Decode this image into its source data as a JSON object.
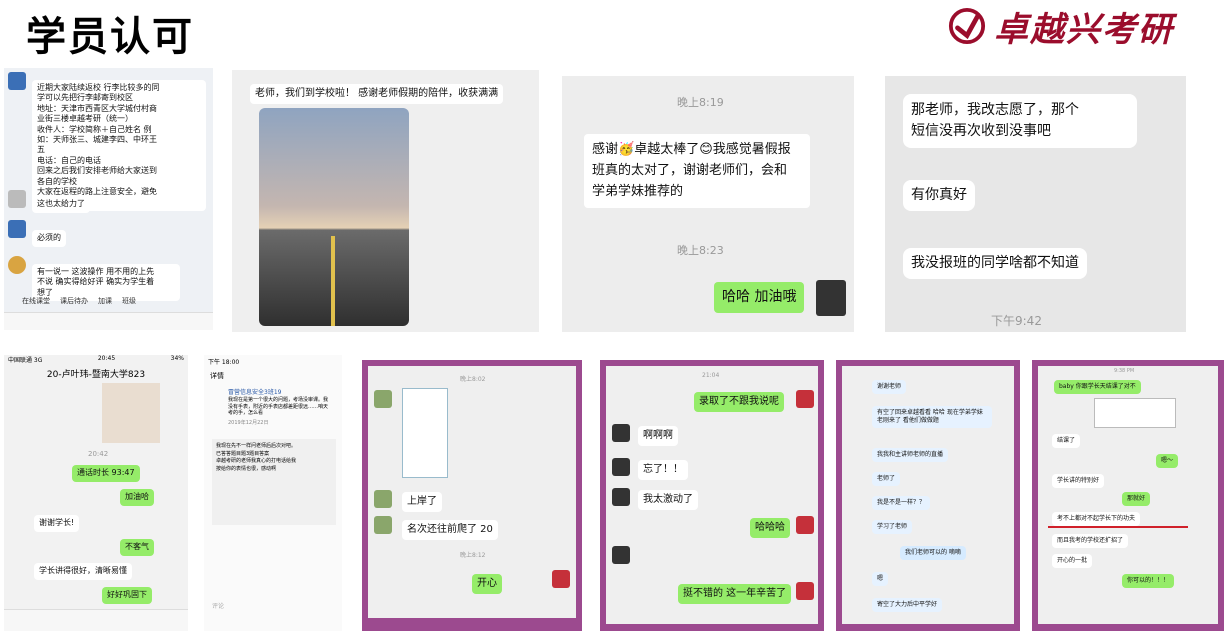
{
  "header": {
    "title": "学员认可",
    "brand": "卓越兴考研"
  },
  "shot1": {
    "msg1": [
      "近期大家陆续返校 行李比较多的同",
      "学可以先把行李邮寄到校区",
      "地址：天津市西青区大学城付村商",
      "业街三楼卓越考研（统一）",
      "收件人：学校简称＋自己姓名 例",
      "如：天师张三、城建李四、中环王",
      "五",
      "电话：自己的电话",
      "回来之后我们安排老师给大家送到",
      "各自的学校",
      "大家在返程的路上注意安全，避免",
      "陌生人搭讪！"
    ],
    "msg2": "这也太给力了",
    "msg3": "必须的",
    "msg4": [
      "有一说一 这波操作 用不用的上先",
      "不说 确实得给好评 确实为学生着",
      "想了"
    ],
    "tabs": [
      "在线课堂",
      "课后待办",
      "加课",
      "班级"
    ]
  },
  "shot2": {
    "msg": "老师，我们到学校啦！ 感谢老师假期的陪伴，收获满满"
  },
  "shot3": {
    "time1": "晚上8:19",
    "msg": [
      "感谢",
      "卓越太棒了",
      "我感觉暑假报",
      "班真的太对了，谢谢老师们，会和",
      "学弟学妹推荐的"
    ],
    "time2": "晚上8:23",
    "reply": "哈哈 加油哦"
  },
  "shot4": {
    "msg1": [
      "那老师，我改志愿了，那个",
      "短信没再次收到没事吧"
    ],
    "msg2": "有你真好",
    "msg3": "我没报班的同学啥都不知道",
    "time": "下午9:42"
  },
  "shot5": {
    "status": [
      "中国联通 3G",
      "20:45",
      "34%"
    ],
    "title": "20-卢叶玮-暨南大学823",
    "time": "20:42",
    "msgs": [
      "通话时长 93:47",
      "加油哈",
      "谢谢学长!",
      "不客气",
      "学长讲得很好，清晰易懂",
      "好好巩固下"
    ]
  },
  "shot6": {
    "status": [
      "下午 18:00"
    ],
    "back": "详情",
    "group": "冒营信息安全3班19",
    "body": [
      "我现在是第一个很大的问题，考场没审课。我",
      "没有手表，附近的手表店都差距很远……咱天",
      "考的手，怎么看"
    ],
    "date": "2019年12月22日",
    "comments": [
      "我现在先不一样问老师后后次对吧。",
      "已答答题目题3题目答案",
      "卓越考研的老师我真心的打电话给我",
      "按给你的表情也很，感动啊"
    ],
    "input_placeholder": "评论"
  },
  "shot7": {
    "time1": "晚上8:02",
    "msgs": [
      "上岸了",
      "名次还往前爬了 20",
      "开心"
    ],
    "time2": "晚上8:12"
  },
  "shot8": {
    "time": "21:04",
    "msgs": [
      "录取了不跟我说呢",
      "啊啊啊",
      "忘了！！",
      "我太激动了",
      "哈哈哈",
      "挺不错的 这一年辛苦了"
    ]
  },
  "shot9": {
    "msgs": [
      "谢谢老师",
      "有空了回来卓越看看 哈哈 现在学弟学妹 老刚来了 看他们做做题",
      "我我和主讲师老师的直播",
      "老师了",
      "我是不是一样？？",
      "学习了老师",
      "我们老师可以的 嘀嘀",
      "嗯",
      "寄空了大力后中平学好"
    ]
  },
  "shot10": {
    "time": "9:38 PM",
    "msgs": [
      "baby 你跟学长天结课了对不",
      "结课了",
      "嗯～",
      "学长讲的特别好",
      "那就好",
      "考不上都对不起学长下的功夫",
      "而且我考的学校还扩招了",
      "开心的一批",
      "你可以的！！！"
    ]
  }
}
